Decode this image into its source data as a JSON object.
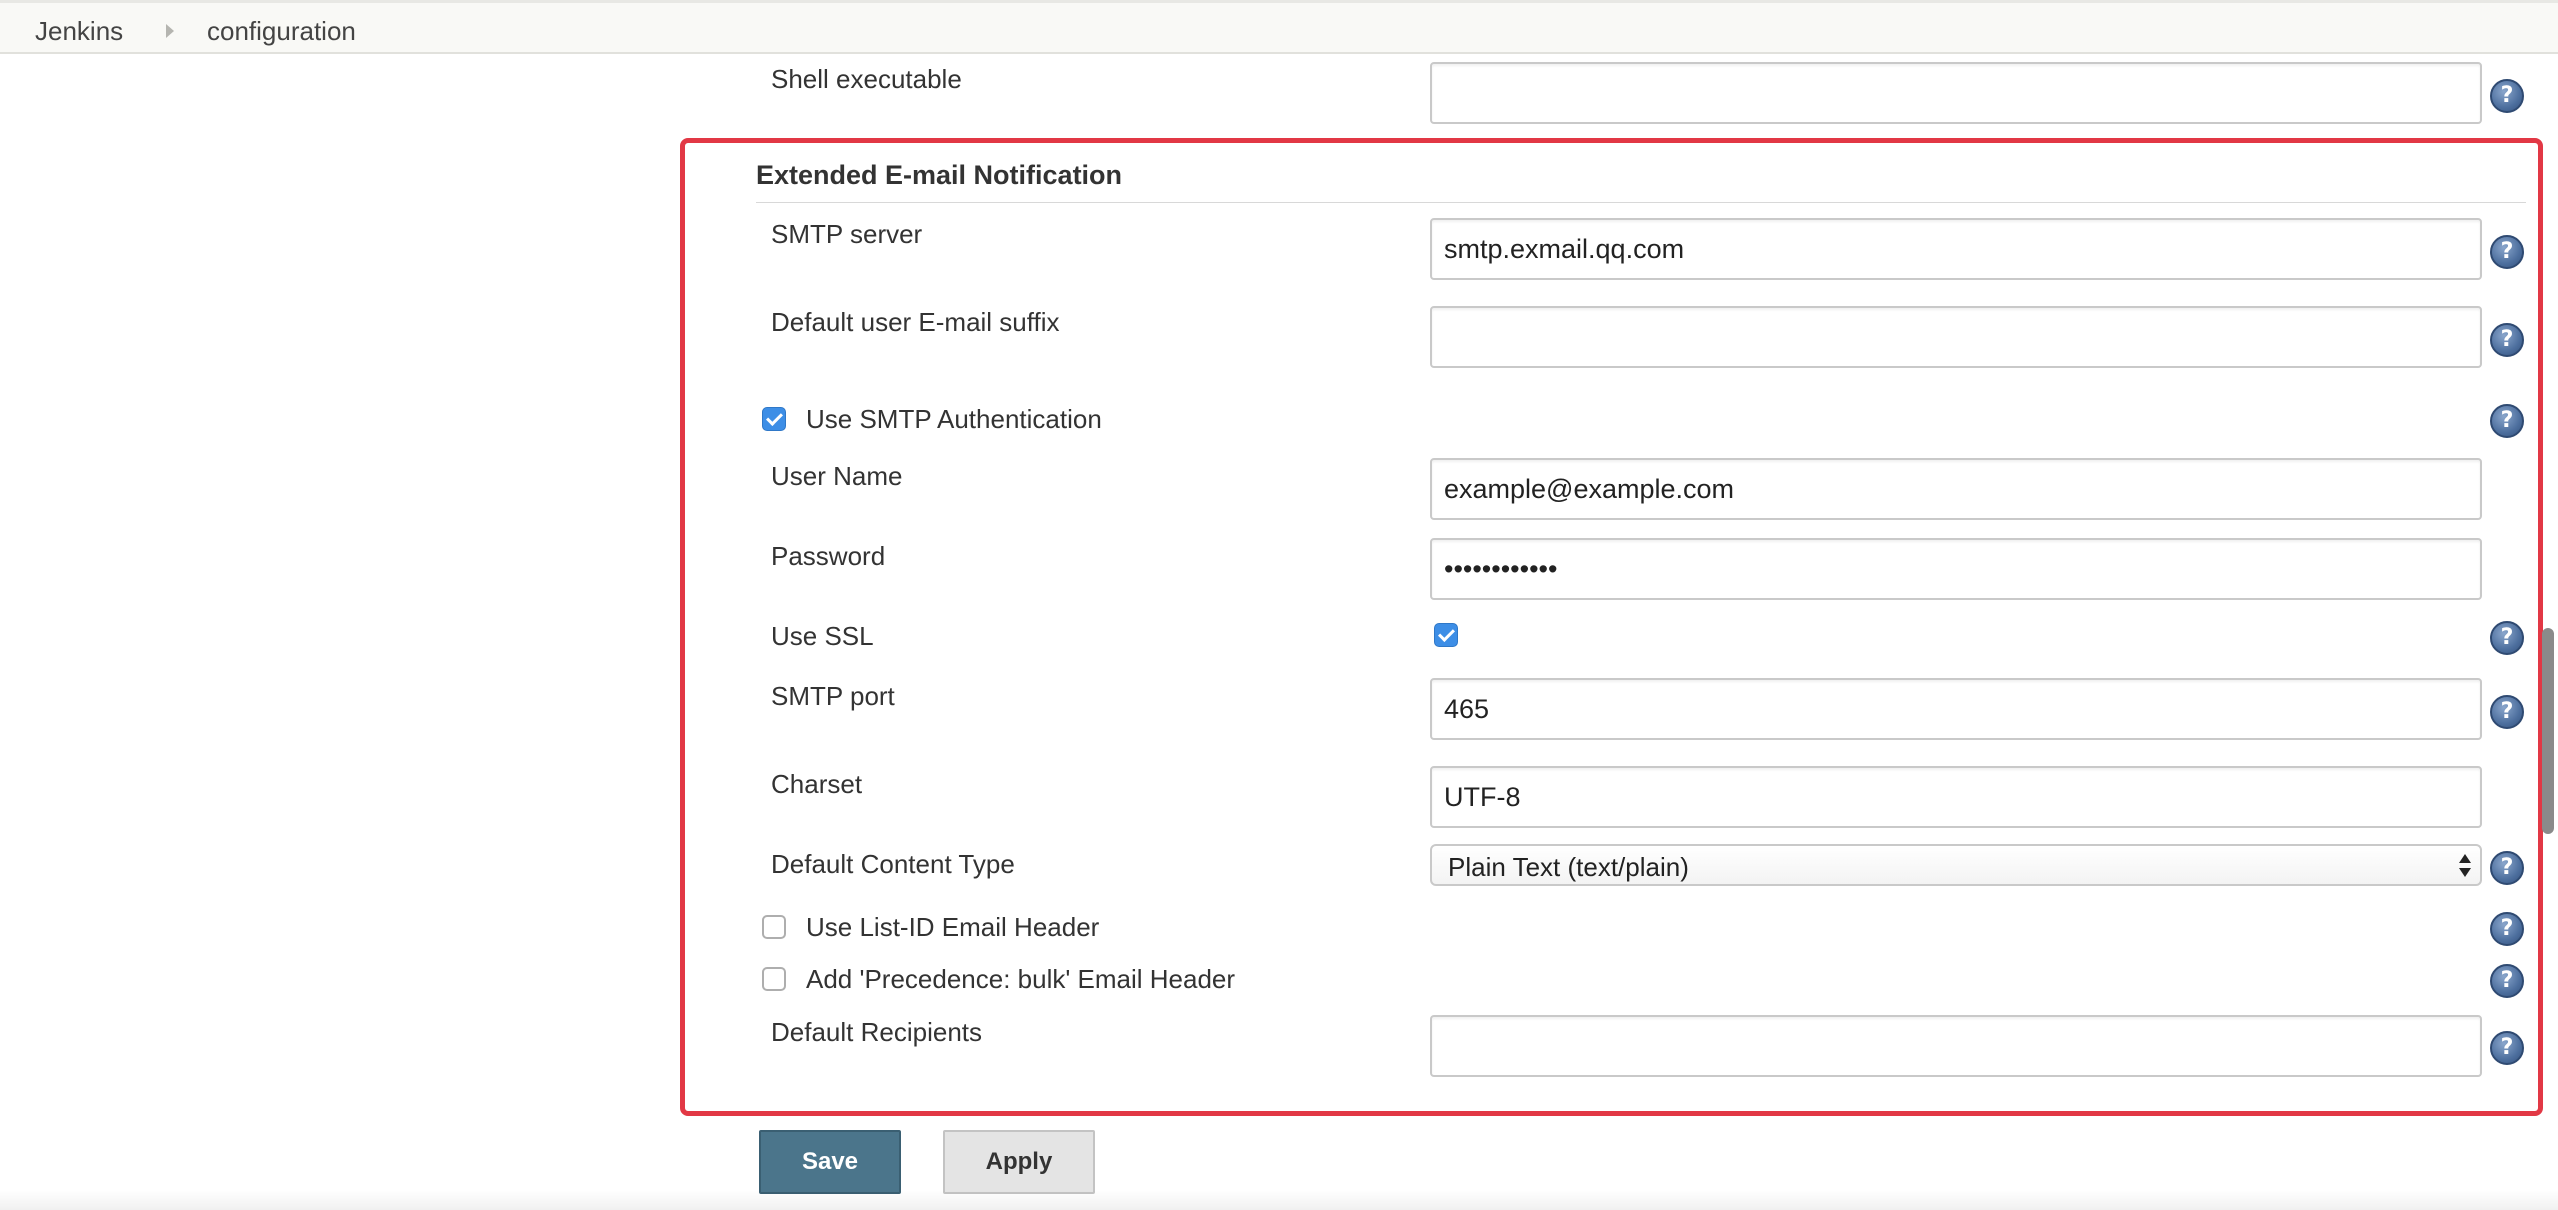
{
  "breadcrumb": {
    "items": [
      "Jenkins",
      "configuration"
    ]
  },
  "shell": {
    "label": "Shell executable",
    "value": ""
  },
  "email_section": {
    "title": "Extended E-mail Notification",
    "smtp_server": {
      "label": "SMTP server",
      "value": "smtp.exmail.qq.com"
    },
    "default_suffix": {
      "label": "Default user E-mail suffix",
      "value": ""
    },
    "use_smtp_auth": {
      "label": "Use SMTP Authentication",
      "checked": true
    },
    "user_name": {
      "label": "User Name",
      "value": "example@example.com"
    },
    "password": {
      "label": "Password",
      "value": "••••••••••••"
    },
    "use_ssl": {
      "label": "Use SSL",
      "checked": true
    },
    "smtp_port": {
      "label": "SMTP port",
      "value": "465"
    },
    "charset": {
      "label": "Charset",
      "value": "UTF-8"
    },
    "content_type": {
      "label": "Default Content Type",
      "selected": "Plain Text (text/plain)"
    },
    "list_id_header": {
      "label": "Use List-ID Email Header",
      "checked": false
    },
    "precedence_header": {
      "label": "Add 'Precedence: bulk' Email Header",
      "checked": false
    },
    "default_recipients": {
      "label": "Default Recipients",
      "value": ""
    }
  },
  "buttons": {
    "save": "Save",
    "apply": "Apply"
  },
  "help_icon": "?",
  "colors": {
    "highlight": "#e23845",
    "save_button": "#4b758b",
    "checkbox": "#3d8ee6"
  }
}
